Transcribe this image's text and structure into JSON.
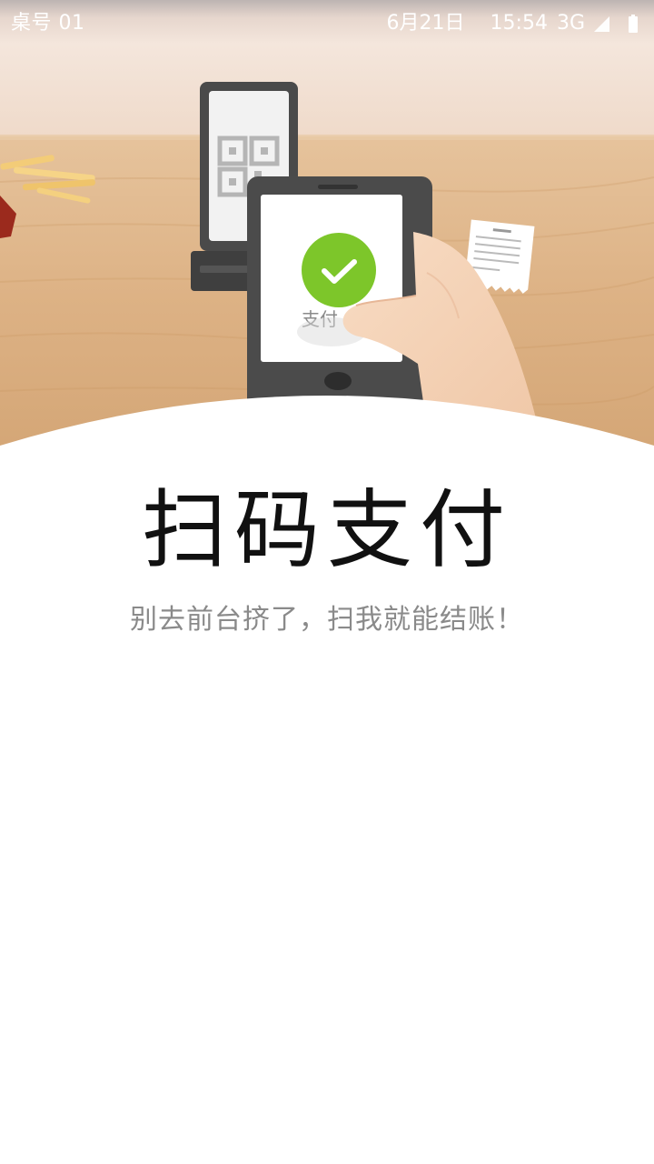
{
  "status_bar": {
    "table_label": "桌号 01",
    "date": "6月21日",
    "time": "15:54",
    "network": "3G"
  },
  "hero": {
    "phone_screen_text": "支付"
  },
  "main": {
    "title": "扫码支付",
    "subtitle": "别去前台挤了，扫我就能结账！"
  },
  "colors": {
    "success_green": "#7DC62A",
    "title_text": "#111111",
    "subtitle_text": "#8A8A8A"
  }
}
